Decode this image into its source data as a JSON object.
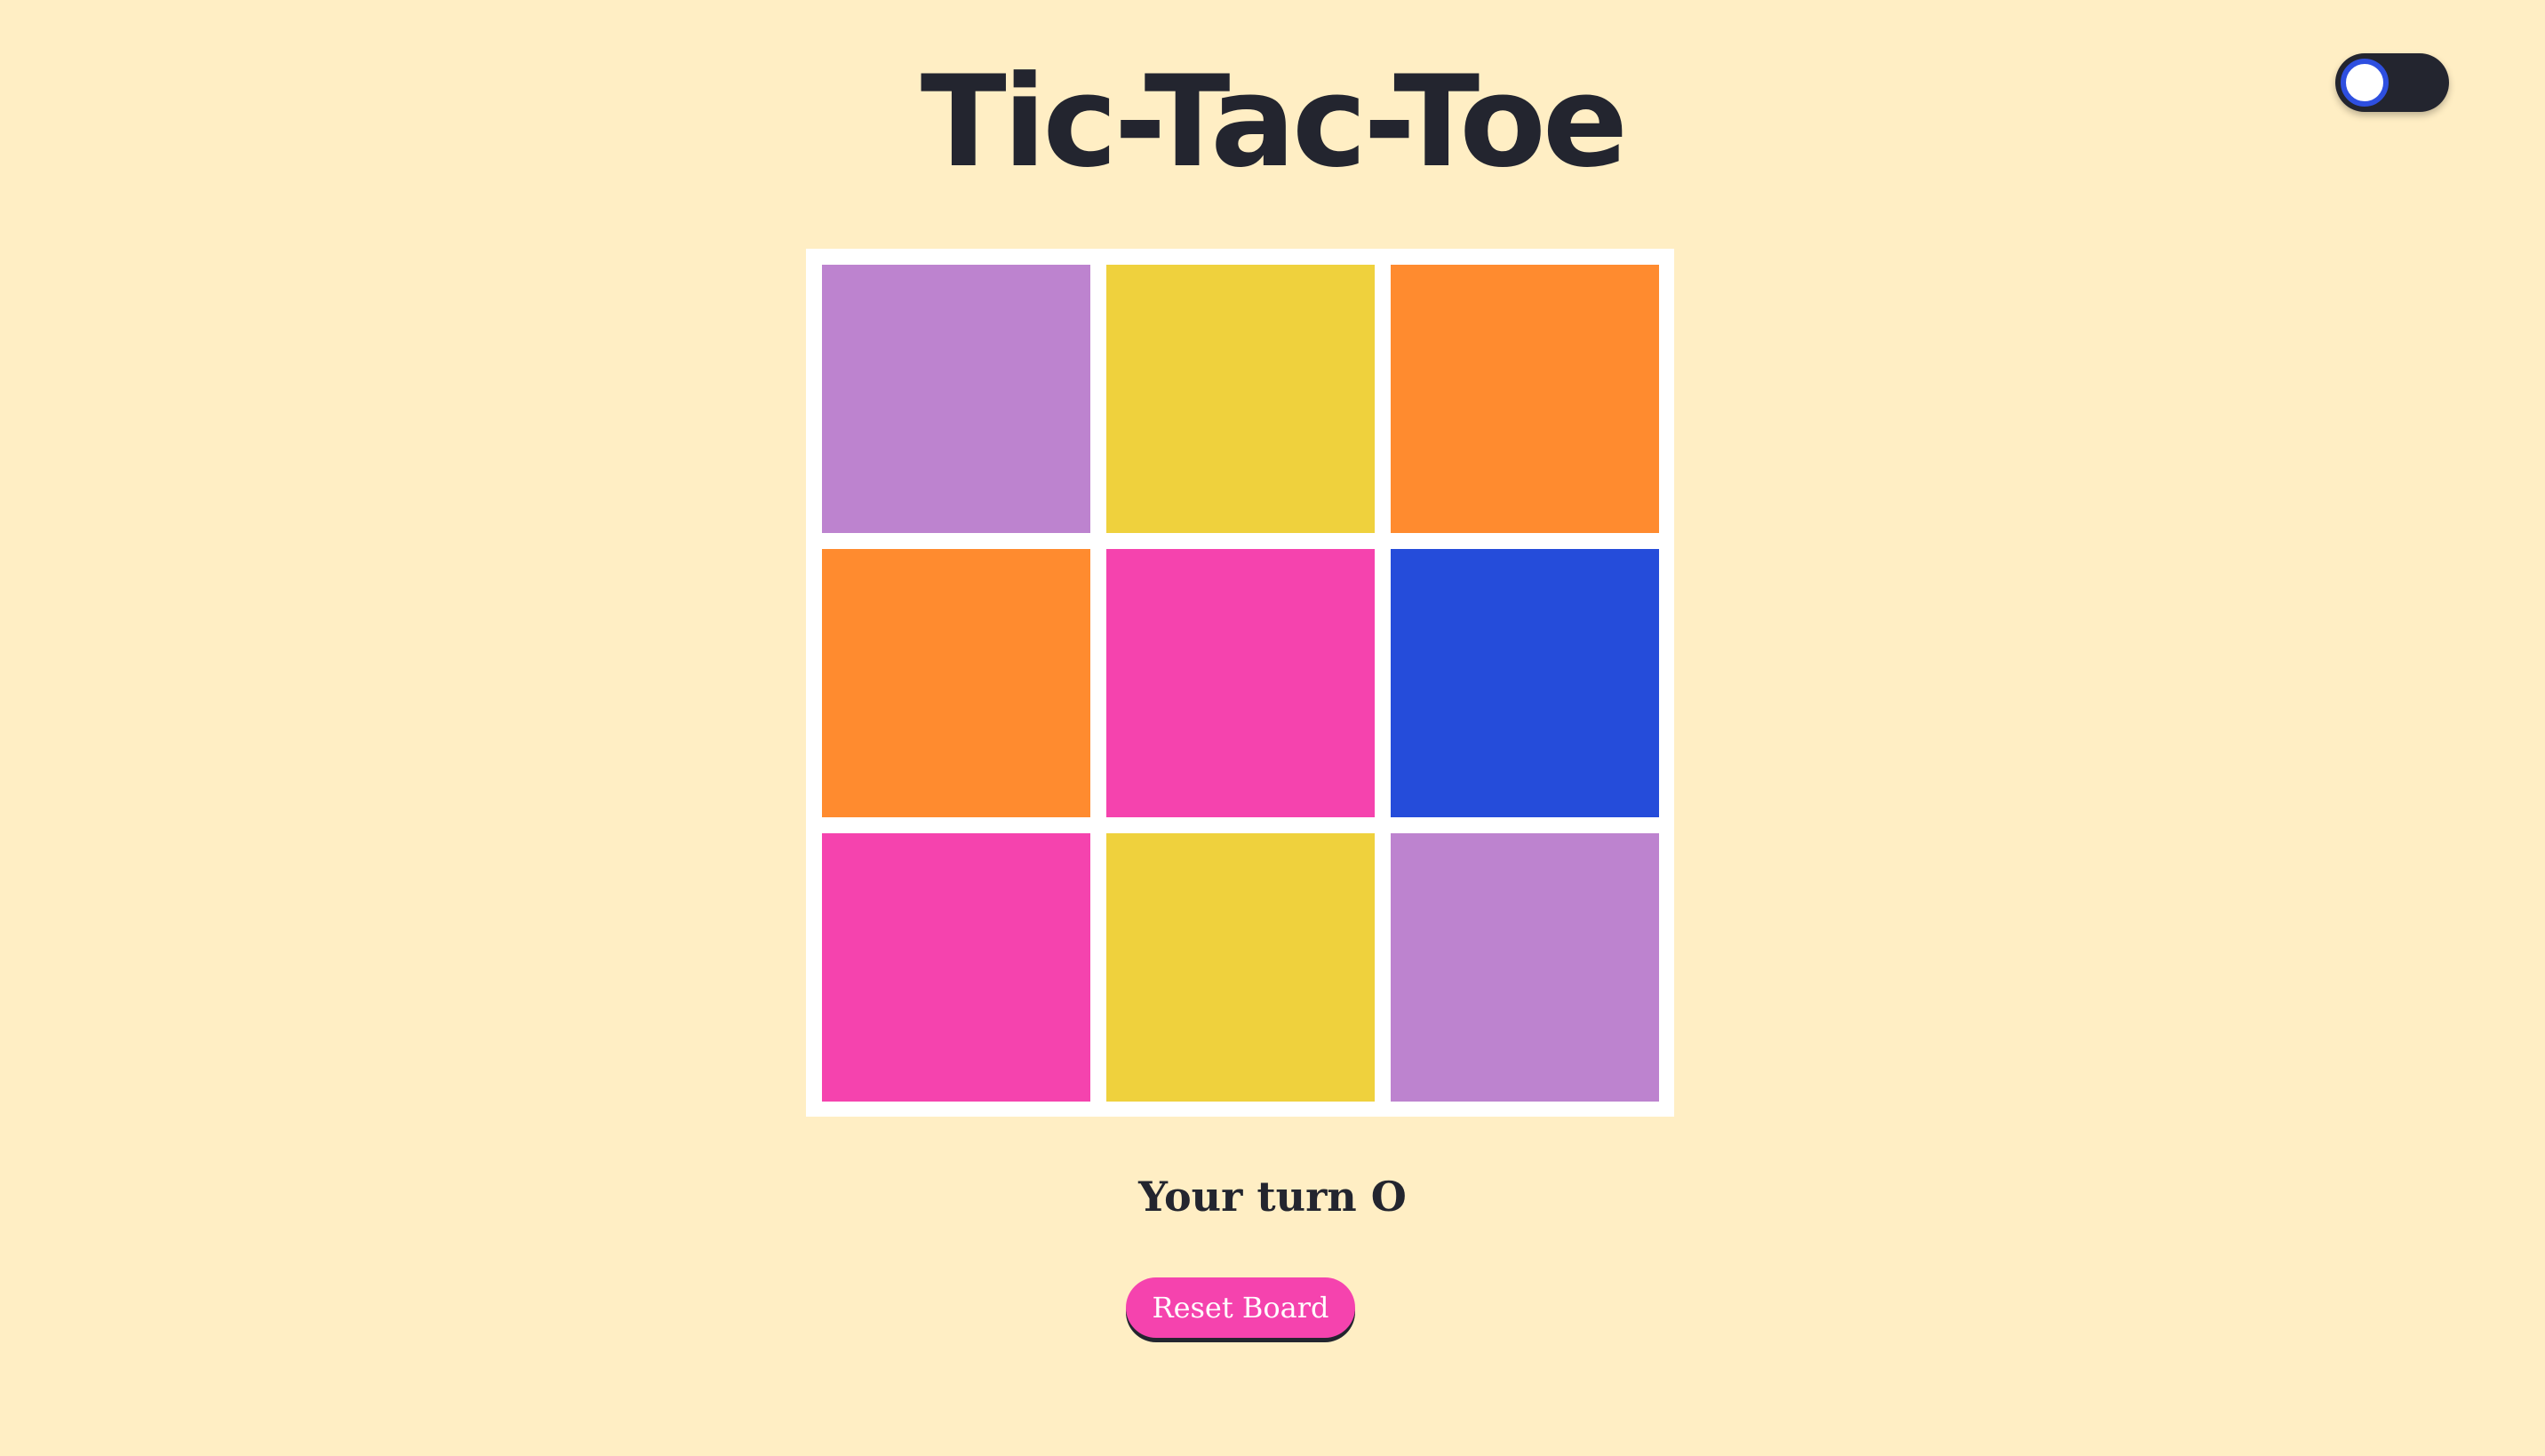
{
  "header": {
    "title": "Tic-Tac-Toe"
  },
  "theme_toggle": {
    "state": "off",
    "track_color": "#23252F",
    "knob_ring_color": "#2E4FE0"
  },
  "colors": {
    "background": "#FFEEC4",
    "board_border": "#FFFFFF",
    "text": "#23252F",
    "accent": "#F543AE"
  },
  "board": {
    "cells": [
      {
        "color": "#BD83CF"
      },
      {
        "color": "#EFD13D"
      },
      {
        "color": "#FF8B2F"
      },
      {
        "color": "#FF8B2F"
      },
      {
        "color": "#F543AE"
      },
      {
        "color": "#254CDA"
      },
      {
        "color": "#F543AE"
      },
      {
        "color": "#EFD13D"
      },
      {
        "color": "#BD83CF"
      }
    ]
  },
  "status": {
    "text": "Your turn O"
  },
  "controls": {
    "reset_label": "Reset Board"
  }
}
